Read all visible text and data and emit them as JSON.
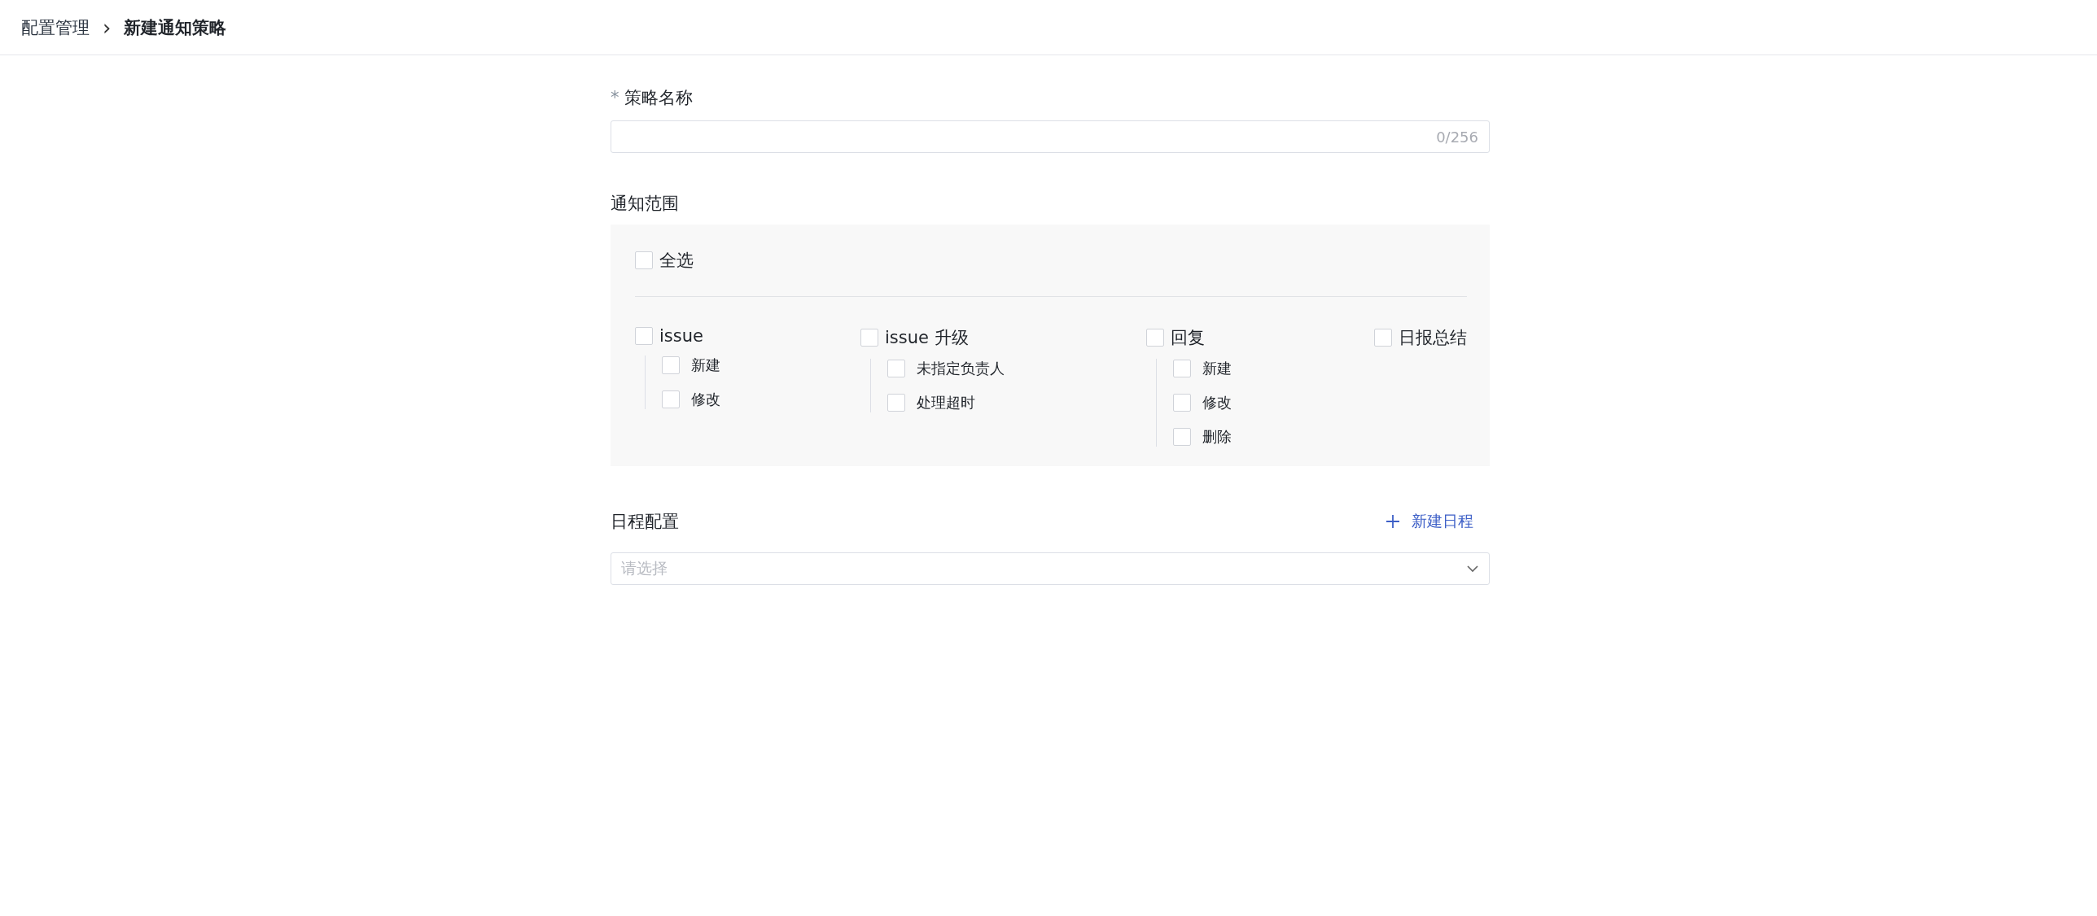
{
  "breadcrumb": {
    "parent": "配置管理",
    "separator": "›",
    "current": "新建通知策略"
  },
  "name_field": {
    "required_mark": "*",
    "label": "策略名称",
    "counter": "0/256"
  },
  "scope": {
    "label": "通知范围",
    "select_all": {
      "label": "全选",
      "checked": false
    },
    "groups": [
      {
        "label": "issue",
        "checked": false,
        "children": [
          {
            "label": "新建",
            "checked": false
          },
          {
            "label": "修改",
            "checked": false
          }
        ]
      },
      {
        "label": "issue 升级",
        "checked": false,
        "children": [
          {
            "label": "未指定负责人",
            "checked": false
          },
          {
            "label": "处理超时",
            "checked": false
          }
        ]
      },
      {
        "label": "回复",
        "checked": false,
        "children": [
          {
            "label": "新建",
            "checked": false
          },
          {
            "label": "修改",
            "checked": false
          },
          {
            "label": "删除",
            "checked": false
          }
        ]
      },
      {
        "label": "日报总结",
        "checked": false
      }
    ]
  },
  "schedule": {
    "label": "日程配置",
    "add_button": "新建日程",
    "select": {
      "placeholder": "请选择"
    }
  }
}
